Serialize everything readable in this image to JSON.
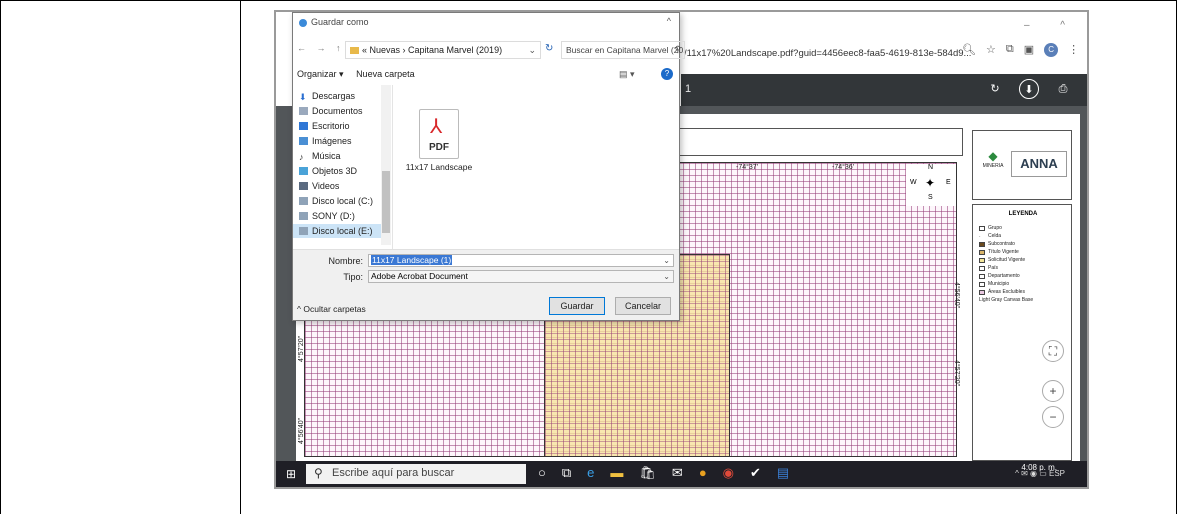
{
  "browser": {
    "address": "/11x17%20Landscape.pdf?guid=4456eec8-faa5-4619-813e-584d9...",
    "icons": [
      "zoom-icon",
      "star-icon",
      "extension-icon",
      "tab-icon",
      "profile-icon",
      "menu-icon"
    ],
    "profile_letter": "C"
  },
  "pdf_viewer": {
    "page_counter": "1",
    "coords_top": [
      "-74°37'",
      "-74°36'"
    ],
    "coords_left": [
      "4°57'20\"",
      "4°56'40\""
    ],
    "coords_right": [
      "4°56'40\"",
      "4°57'20\""
    ],
    "compass": {
      "n": "N",
      "s": "S",
      "w": "W",
      "e": "E"
    },
    "logo_text": "ANNA",
    "logo_sub": "MINERIA",
    "legend": {
      "title": "LEYENDA",
      "items": [
        "Grupo",
        "Celda",
        "Subcontrato",
        "Título Vigente",
        "Solicitud Vigente",
        "País",
        "Departamento",
        "Municipio",
        "Áreas Excluibles",
        "Light Gray Canvas Base"
      ]
    }
  },
  "dialog": {
    "title": "Guardar como",
    "breadcrumb": "« Nuevas › Capitana Marvel (2019)",
    "search_placeholder": "Buscar en Capitana Marvel (20...",
    "organize": "Organizar ▾",
    "new_folder": "Nueva carpeta",
    "nav_items": [
      "Descargas",
      "Documentos",
      "Escritorio",
      "Imágenes",
      "Música",
      "Objetos 3D",
      "Videos",
      "Disco local (C:)",
      "SONY (D:)",
      "Disco local (E:)"
    ],
    "file_label": "PDF",
    "file_name": "11x17 Landscape",
    "name_label": "Nombre:",
    "name_value": "11x17 Landscape (1)",
    "type_label": "Tipo:",
    "type_value": "Adobe Acrobat Document",
    "hide_folders": "Ocultar carpetas",
    "save_button": "Guardar",
    "cancel_button": "Cancelar"
  },
  "taskbar": {
    "search_placeholder": "Escribe aquí para buscar",
    "lang": "ESP",
    "time": "4:08 p. m."
  }
}
